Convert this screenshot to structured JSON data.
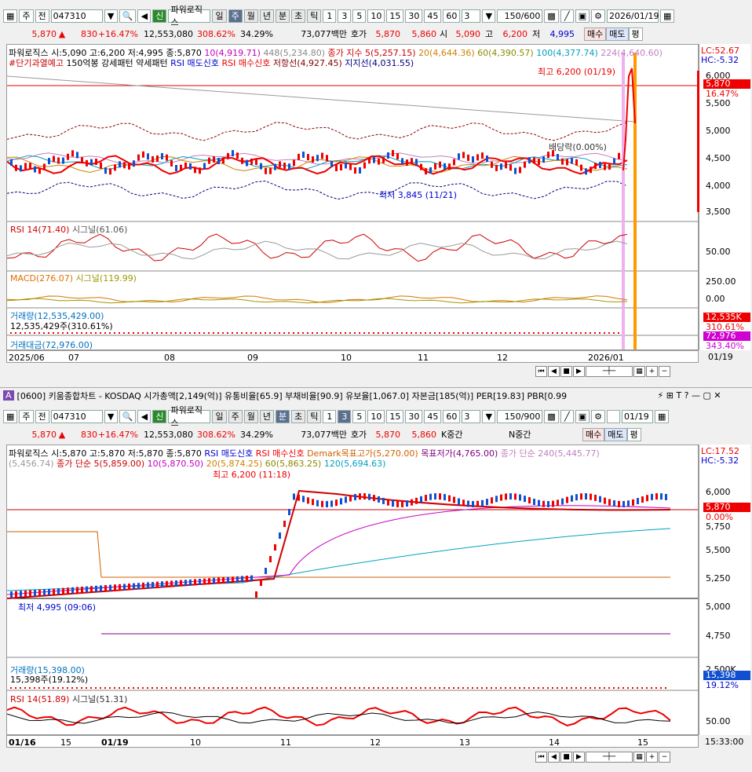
{
  "top": {
    "toolbar": {
      "type": "주",
      "prev": "전",
      "code": "047310",
      "name": "파워로직스",
      "sin": "신",
      "periods": [
        "일",
        "주",
        "월",
        "년",
        "분",
        "초",
        "틱"
      ],
      "active_period": "주",
      "nums": [
        "1",
        "3",
        "5",
        "10",
        "15",
        "30",
        "45",
        "60"
      ],
      "num_sel": "3",
      "count": "150/600",
      "date": "2026/01/19"
    },
    "quote": {
      "price": "5,870",
      "change": "830",
      "pct": "+16.47%",
      "volume": "12,553,080",
      "vol_ratio": "308.62%",
      "turnover": "34.29%",
      "amount": "73,077백만",
      "hoga_label": "호가",
      "ask": "5,870",
      "bid": "5,860",
      "open_label": "시",
      "open": "5,090",
      "high_label": "고",
      "high": "6,200",
      "low_label": "저",
      "low": "4,995",
      "buy": "매수",
      "sell": "매도",
      "eval": "평"
    },
    "legend1": {
      "title": "파워로직스 시:5,090 고:6,200 저:4,995 종:5,870",
      "ma10": "10(4,919.71)",
      "ma448": "448(5,234.80)",
      "close_idx": "종가 지수 5(5,257.15)",
      "ma20": "20(4,644.36)",
      "ma60": "60(4,390.57)",
      "ma100": "100(4,377.74)",
      "ma224": "224(4,640.60)"
    },
    "legend2": {
      "a": "#단기과열예고",
      "b": "150억봉 강세패턴",
      "c": "약세패턴",
      "rsi_sell": "RSI 매도신호",
      "rsi_buy": "RSI 매수신호",
      "resist": "저항선(4,927.45)",
      "support": "지지선(4,031.55)"
    },
    "lc": "LC:52.67",
    "hc": "HC:-5.32",
    "annot": {
      "high": "최고 6,200 (01/19)",
      "low": "최저 3,845 (11/21)",
      "div": "배당락(0.00%)"
    },
    "yaxis": [
      "6,000",
      "5,500",
      "5,000",
      "4,500",
      "4,000",
      "3,500"
    ],
    "price_tag": "5,870",
    "pct_tag": "16.47%",
    "rsi": {
      "label": "RSI 14(71.40)",
      "signal": "시그널(61.06)",
      "y": "50.00"
    },
    "macd": {
      "label": "MACD(276.07)",
      "signal": "시그널(119.99)",
      "y1": "250.00",
      "y2": "0.00"
    },
    "vol": {
      "label": "거래량(12,535,429.00)",
      "sub": "12,535,429주(310.61%)",
      "tag": "12,535K",
      "tag2": "310.61%"
    },
    "amt": {
      "label": "거래대금(72,976.00)",
      "tag": "72,976",
      "tag2": "343.40%"
    },
    "xaxis": [
      "2025/06",
      "07",
      "08",
      "09",
      "10",
      "11",
      "12",
      "2026/01"
    ],
    "xright": "01/19"
  },
  "bottom": {
    "title": "[0600] 키움종합차트 - KOSDAQ 시가총액[2,149(억)] 유통비율[65.9] 부채비율[90.9] 유보율[1,067.0] 자본금[185(억)] PER[19.83] PBR[0.99",
    "toolbar": {
      "type": "주",
      "prev": "전",
      "code": "047310",
      "name": "파워로직스",
      "sin": "신",
      "periods": [
        "일",
        "주",
        "월",
        "년",
        "분",
        "초",
        "틱"
      ],
      "active_period": "분",
      "nums": [
        "1",
        "3",
        "5",
        "10",
        "15",
        "30",
        "45",
        "60"
      ],
      "num_sel": "3",
      "count": "150/900",
      "date": "01/19"
    },
    "quote": {
      "price": "5,870",
      "change": "830",
      "pct": "+16.47%",
      "volume": "12,553,080",
      "vol_ratio": "308.62%",
      "turnover": "34.29%",
      "amount": "73,077백만",
      "hoga_label": "호가",
      "ask": "5,870",
      "bid": "5,860",
      "k": "K중간",
      "n": "N중간",
      "buy": "매수",
      "sell": "매도",
      "eval": "평"
    },
    "legend1": {
      "title": "파워로직스 시:5,870 고:5,870 저:5,870 종:5,870",
      "rsi_sell": "RSI 매도신호",
      "rsi_buy": "RSI 매수신호",
      "demark_hi": "Demark목표고가(5,270.00)",
      "demark_lo": "목표저가(4,765.00)",
      "close240": "종가 단순 240(5,445.77)"
    },
    "legend2": {
      "a": "(5,456.74)",
      "close5": "종가 단순 5(5,859.00)",
      "ma10": "10(5,870.50)",
      "ma20": "20(5,874.25)",
      "ma60": "60(5,863.25)",
      "ma120": "120(5,694.63)"
    },
    "lc": "LC:17.52",
    "hc": "HC:-5.32",
    "annot": {
      "high": "최고 6,200 (11:18)",
      "low": "최저 4,995 (09:06)"
    },
    "yaxis": [
      "6,000",
      "5,750",
      "5,500",
      "5,250",
      "5,000",
      "4,750"
    ],
    "price_tag": "5,870",
    "pct_tag": "0.00%",
    "vol": {
      "label": "거래량(15,398.00)",
      "sub": "15,398주(19.12%)",
      "y": "2,500K",
      "tag": "15,398",
      "tag2": "19.12%"
    },
    "rsi": {
      "label": "RSI 14(51.89)",
      "signal": "시그널(51.31)",
      "y": "50.00"
    },
    "xaxis": [
      "01/16",
      "15",
      "01/19",
      "10",
      "11",
      "12",
      "13",
      "14",
      "15"
    ],
    "xright": "15:33:00"
  }
}
